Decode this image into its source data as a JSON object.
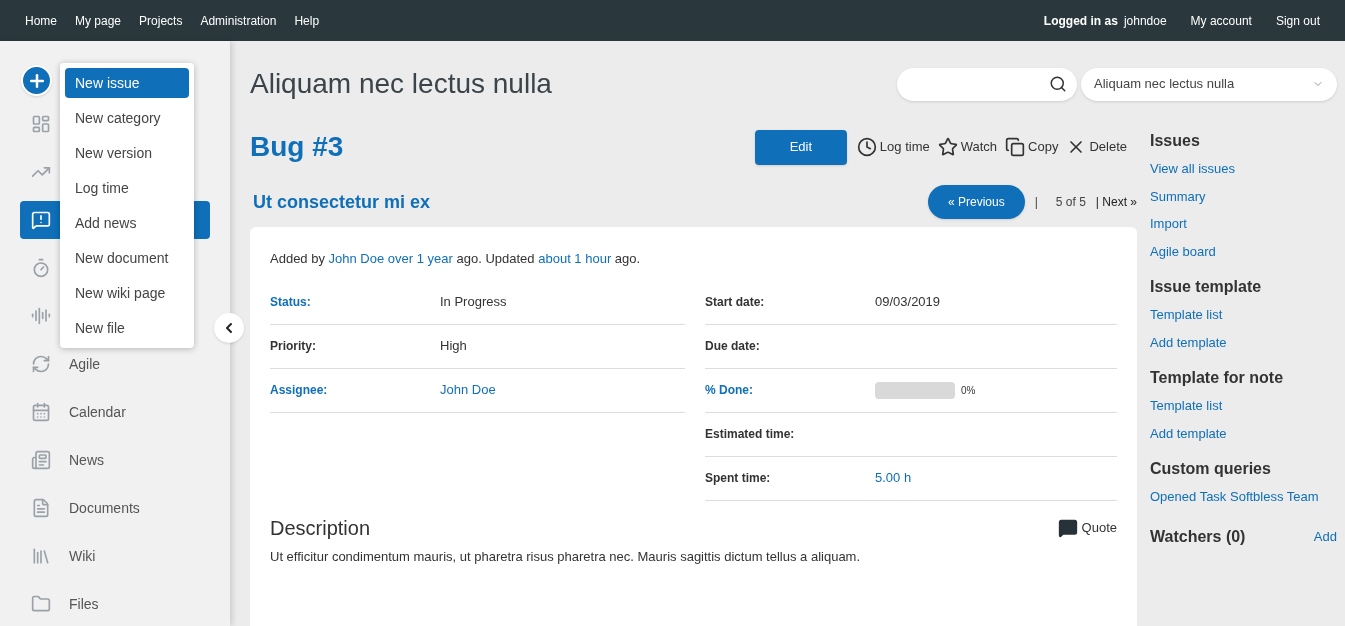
{
  "top_nav": {
    "left": [
      "Home",
      "My page",
      "Projects",
      "Administration",
      "Help"
    ],
    "logged_in_label": "Logged in as",
    "user": "johndoe",
    "right": [
      "My account",
      "Sign out"
    ]
  },
  "sidebar": {
    "items": [
      {
        "selected": false
      },
      {
        "selected": false
      },
      {
        "selected": true
      },
      {
        "selected": false
      },
      {
        "selected": false
      },
      {
        "label": "Agile",
        "selected": false
      },
      {
        "label": "Calendar",
        "selected": false
      },
      {
        "label": "News",
        "selected": false
      },
      {
        "label": "Documents",
        "selected": false
      },
      {
        "label": "Wiki",
        "selected": false
      },
      {
        "label": "Files",
        "selected": false
      }
    ]
  },
  "new_menu": {
    "items": [
      {
        "label": "New issue",
        "selected": true
      },
      {
        "label": "New category",
        "selected": false
      },
      {
        "label": "New version",
        "selected": false
      },
      {
        "label": "Log time",
        "selected": false
      },
      {
        "label": "Add news",
        "selected": false
      },
      {
        "label": "New document",
        "selected": false
      },
      {
        "label": "New wiki page",
        "selected": false
      },
      {
        "label": "New file",
        "selected": false
      }
    ]
  },
  "project_title": "Aliquam nec lectus nulla",
  "project_select": {
    "value": "Aliquam nec lectus nulla"
  },
  "issue": {
    "title": "Bug #3",
    "subject": "Ut consectetur mi ex",
    "actions": [
      {
        "kind": "primary",
        "label": "Edit"
      },
      {
        "kind": "clock",
        "label": "Log time"
      },
      {
        "kind": "star",
        "label": "Watch"
      },
      {
        "kind": "copy",
        "label": "Copy"
      },
      {
        "kind": "delete",
        "label": "Delete"
      }
    ],
    "pager": {
      "previous": "« Previous",
      "separator": "|",
      "position": "5 of 5",
      "next": "| Next »"
    },
    "author_line": {
      "added_by": "Added by",
      "author": "John Doe",
      "created": "over 1 year",
      "updated_label": "ago. Updated",
      "updated": "about 1 hour",
      "end": "ago."
    },
    "attributes_left": [
      {
        "label": "Status:",
        "label_link": true,
        "value": "In Progress",
        "value_link": false
      },
      {
        "label": "Priority:",
        "label_link": false,
        "value": "High",
        "value_link": false
      },
      {
        "label": "Assignee:",
        "label_link": true,
        "value": "John Doe",
        "value_link": true
      }
    ],
    "attributes_right": [
      {
        "kind": "text",
        "label": "Start date:",
        "label_link": false,
        "value": "09/03/2019",
        "value_link": false
      },
      {
        "kind": "text",
        "label": "Due date:",
        "label_link": false
      },
      {
        "kind": "progress",
        "label": "% Done:",
        "label_link": true,
        "level": 0,
        "reading": "0%"
      },
      {
        "kind": "text",
        "label": "Estimated time:",
        "label_link": false
      },
      {
        "kind": "text",
        "label": "Spent time:",
        "label_link": false,
        "value": "5.00 h",
        "value_link": true
      }
    ],
    "description_heading": "Description",
    "quote": "Quote",
    "description": "Ut efficitur condimentum mauris, ut pharetra risus pharetra nec. Mauris sagittis dictum tellus a aliquam."
  },
  "right_sidebar": {
    "sections": [
      {
        "heading": "Issues",
        "links": [
          "View all issues",
          "Summary",
          "Import",
          "Agile board"
        ]
      },
      {
        "heading": "Issue template",
        "links": [
          "Template list",
          "Add template"
        ]
      },
      {
        "heading": "Template for note",
        "links": [
          "Template list",
          "Add template"
        ]
      },
      {
        "heading": "Custom queries",
        "links": [
          "Opened Task Softbless Team"
        ]
      }
    ],
    "watchers": {
      "heading": "Watchers (0)",
      "add": "Add"
    }
  }
}
